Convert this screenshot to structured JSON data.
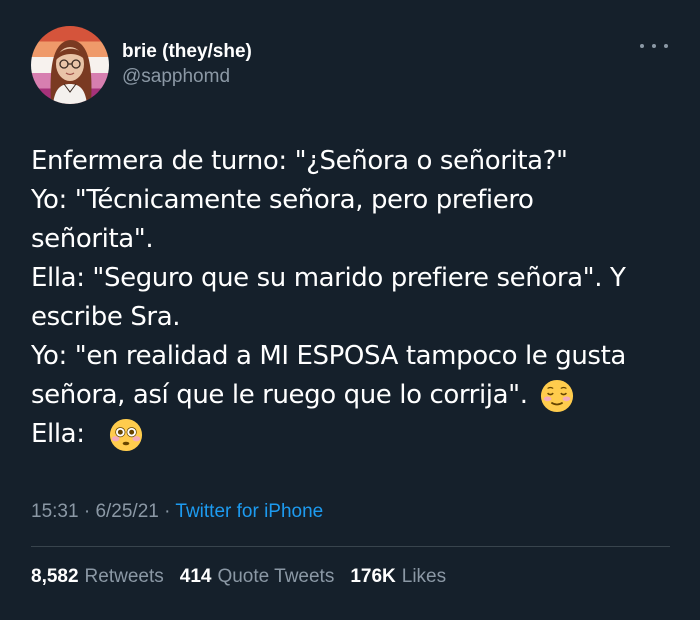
{
  "author": {
    "display_name": "brie (they/she)",
    "handle": "@sapphomd",
    "avatar": "illustrated-avatar"
  },
  "tweet": {
    "lines": [
      "Enfermera de turno: \"¿Señora o señorita?\"",
      "Yo: \"Técnicamente señora, pero prefiero",
      "señorita\".",
      "Ella: \"Seguro que su marido prefiere señora\". Y",
      "escribe Sra.",
      "Yo: \"en realidad a MI ESPOSA tampoco le gusta",
      "señora, así que le ruego que lo corrija\".",
      "Ella:"
    ],
    "emojis": [
      "smiling-face-icon",
      "flushed-face-icon"
    ]
  },
  "meta": {
    "time": "15:31",
    "separator1": "·",
    "date": "6/25/21",
    "separator2": "·",
    "source": "Twitter for iPhone"
  },
  "stats": {
    "retweets_count": "8,582",
    "retweets_label": "Retweets",
    "quotes_count": "414",
    "quotes_label": "Quote Tweets",
    "likes_count": "176K",
    "likes_label": "Likes"
  },
  "colors": {
    "background": "#15202b",
    "text": "#ffffff",
    "secondary": "#8b98a5",
    "link": "#1d9bf0",
    "divider": "#38444d"
  }
}
